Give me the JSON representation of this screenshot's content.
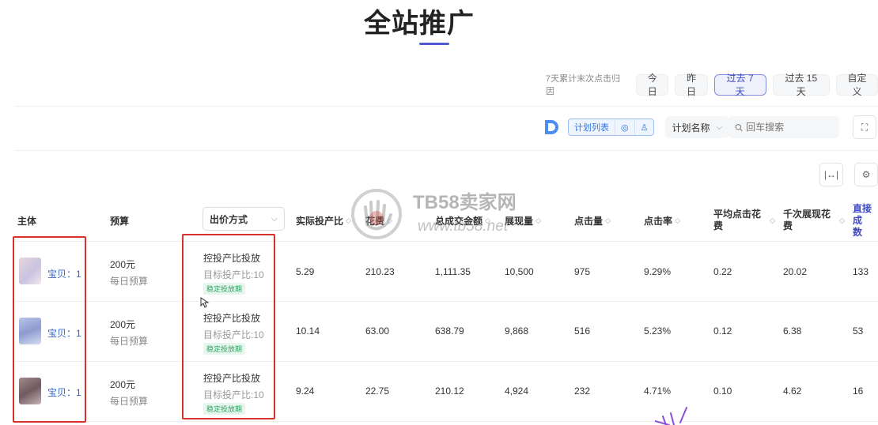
{
  "page": {
    "title": "全站推广"
  },
  "date_range": {
    "note": "7天累计末次点击归因",
    "options": [
      "今日",
      "昨日",
      "过去 7 天",
      "过去 15 天",
      "自定义"
    ],
    "selected": "过去 7 天"
  },
  "toolbar": {
    "view_tabs": [
      "计划列表",
      "◎",
      "♙"
    ],
    "filter_select": "计划名称",
    "search_placeholder": "回车搜索",
    "expand_icon": "⛶",
    "fit_icon": "|↔|",
    "settings_icon": "⚙"
  },
  "table": {
    "headers": {
      "subject": "主体",
      "budget": "预算",
      "bid_mode": "出价方式",
      "actual_roi": "实际投产比",
      "spend": "花费",
      "gmv": "总成交金额",
      "impressions": "展现量",
      "clicks": "点击量",
      "ctr": "点击率",
      "avg_cpc_line1": "平均点击花",
      "avg_cpc_line2": "费",
      "cpm_line1": "千次展现花",
      "cpm_line2": "费",
      "direct_line1": "直接成",
      "direct_line2": "数"
    },
    "rows": [
      {
        "item": "宝贝：1",
        "budget": "200元",
        "budget_type": "每日预算",
        "bid": "控投产比投放",
        "target": "目标投产比:10",
        "tag": "稳定投放期",
        "actual_roi": "5.29",
        "spend": "210.23",
        "gmv": "1,111.35",
        "impressions": "10,500",
        "clicks": "975",
        "ctr": "9.29%",
        "avg_cpc": "0.22",
        "cpm": "20.02",
        "direct": "133"
      },
      {
        "item": "宝贝：1",
        "budget": "200元",
        "budget_type": "每日预算",
        "bid": "控投产比投放",
        "target": "目标投产比:10",
        "tag": "稳定投放期",
        "actual_roi": "10.14",
        "spend": "63.00",
        "gmv": "638.79",
        "impressions": "9,868",
        "clicks": "516",
        "ctr": "5.23%",
        "avg_cpc": "0.12",
        "cpm": "6.38",
        "direct": "53"
      },
      {
        "item": "宝贝：1",
        "budget": "200元",
        "budget_type": "每日预算",
        "bid": "控投产比投放",
        "target": "目标投产比:10",
        "tag": "稳定投放期",
        "actual_roi": "9.24",
        "spend": "22.75",
        "gmv": "210.12",
        "impressions": "4,924",
        "clicks": "232",
        "ctr": "4.71%",
        "avg_cpc": "0.10",
        "cpm": "4.62",
        "direct": "16"
      }
    ]
  },
  "watermark": {
    "title": "TB58卖家网",
    "url": "www.tb58.net"
  },
  "colors": {
    "accent": "#4f5bd5",
    "highlight_box": "#d9312b",
    "tag_green": "#2fa463",
    "link_blue": "#3366cc"
  }
}
